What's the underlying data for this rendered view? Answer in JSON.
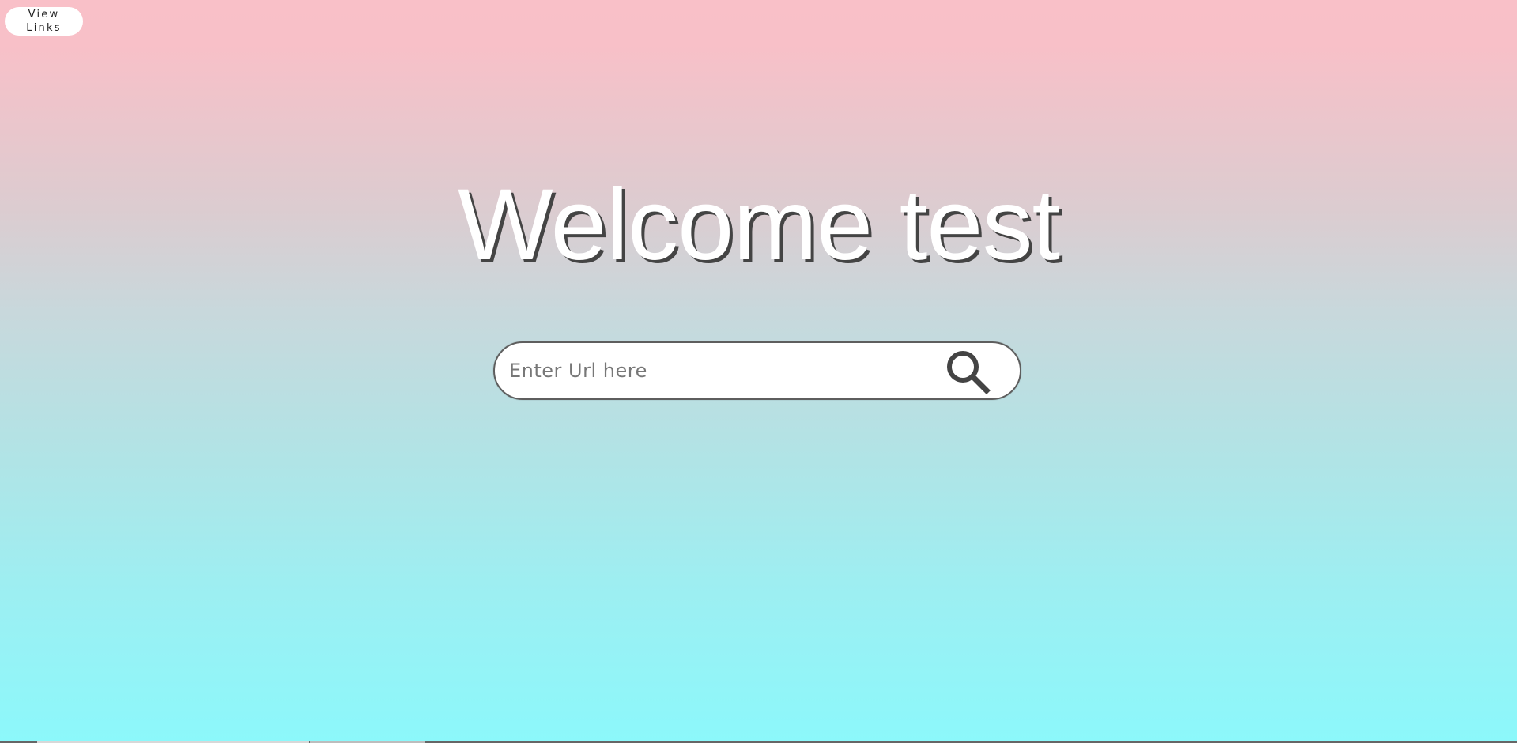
{
  "nav": {
    "view_links_line1": "View",
    "view_links_line2": "Links"
  },
  "heading": {
    "text": "Welcome test"
  },
  "search": {
    "placeholder": "Enter Url here",
    "value": "",
    "icon": "search-icon"
  },
  "colors": {
    "gradient_top": "#f9c0c8",
    "gradient_bottom": "#8cf8fb",
    "heading_text": "#ffffff",
    "heading_shadow": "#444444",
    "search_border": "#5e5e5e",
    "search_icon": "#444444"
  }
}
